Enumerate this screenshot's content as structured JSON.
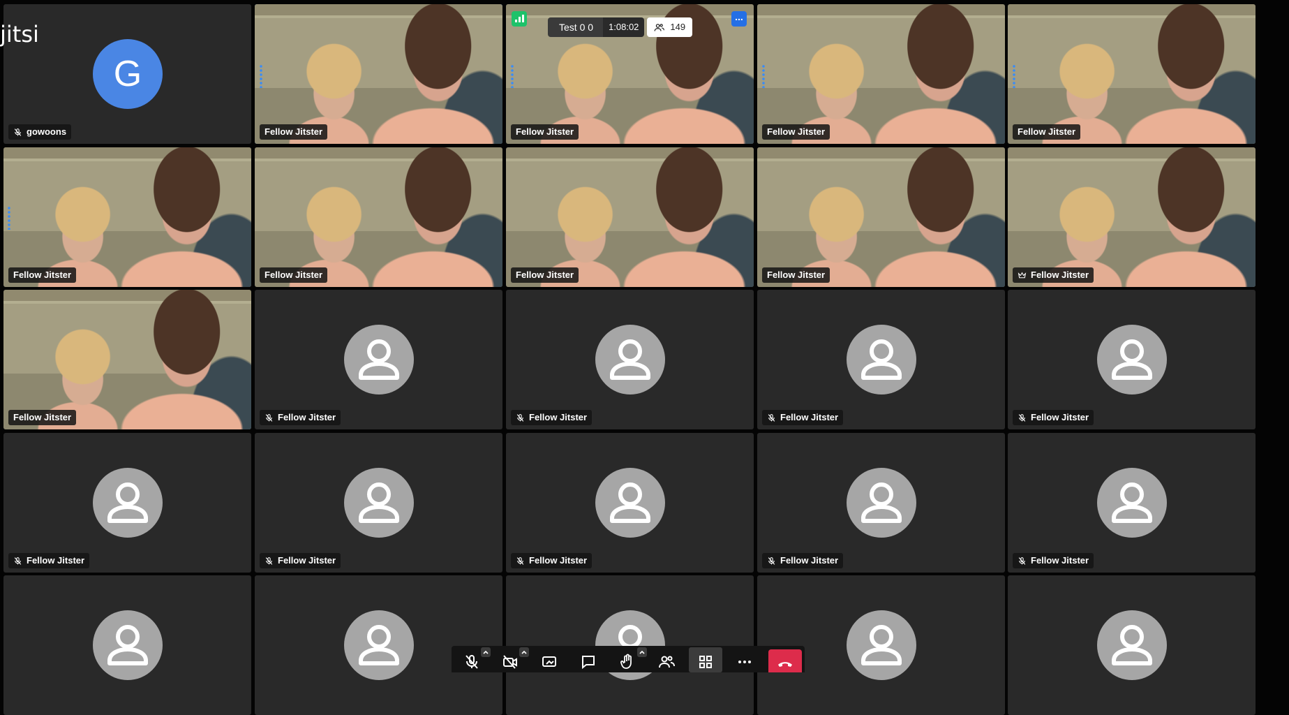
{
  "brand": {
    "watermark_text": "jitsi"
  },
  "meeting": {
    "title": "Test 0 0",
    "duration": "1:08:02",
    "participant_count": "149"
  },
  "colors": {
    "background": "#040404",
    "tile": "#292929",
    "selected_border": "#246fe5",
    "avatar_gray": "#a6a6a6",
    "avatar_letter_bg": "#4a86e4",
    "connection_good": "#1ec26a",
    "hangup_red": "#dd2c4b"
  },
  "participants": [
    {
      "name": "gowoons",
      "kind": "letter",
      "initial": "G",
      "muted": true
    },
    {
      "name": "Fellow Jitster",
      "kind": "video",
      "selected": true
    },
    {
      "name": "Fellow Jitster",
      "kind": "video"
    },
    {
      "name": "Fellow Jitster",
      "kind": "video"
    },
    {
      "name": "Fellow Jitster",
      "kind": "video"
    },
    {
      "name": "Fellow Jitster",
      "kind": "video"
    },
    {
      "name": "Fellow Jitster",
      "kind": "video"
    },
    {
      "name": "Fellow Jitster",
      "kind": "video"
    },
    {
      "name": "Fellow Jitster",
      "kind": "video"
    },
    {
      "name": "Fellow Jitster",
      "kind": "video",
      "moderator": true
    },
    {
      "name": "Fellow Jitster",
      "kind": "video"
    },
    {
      "name": "Fellow Jitster",
      "kind": "avatar",
      "muted": true
    },
    {
      "name": "Fellow Jitster",
      "kind": "avatar",
      "muted": true
    },
    {
      "name": "Fellow Jitster",
      "kind": "avatar",
      "muted": true
    },
    {
      "name": "Fellow Jitster",
      "kind": "avatar",
      "muted": true
    },
    {
      "name": "Fellow Jitster",
      "kind": "avatar",
      "muted": true
    },
    {
      "name": "Fellow Jitster",
      "kind": "avatar",
      "muted": true
    },
    {
      "name": "Fellow Jitster",
      "kind": "avatar",
      "muted": true
    },
    {
      "name": "Fellow Jitster",
      "kind": "avatar",
      "muted": true
    },
    {
      "name": "Fellow Jitster",
      "kind": "avatar",
      "muted": true
    },
    {
      "name": "",
      "kind": "avatar"
    },
    {
      "name": "",
      "kind": "avatar"
    },
    {
      "name": "",
      "kind": "avatar"
    },
    {
      "name": "",
      "kind": "avatar"
    },
    {
      "name": "",
      "kind": "avatar"
    }
  ],
  "toolbar": {
    "buttons": [
      {
        "icon": "microphone-muted-icon"
      },
      {
        "icon": "camera-off-icon"
      },
      {
        "icon": "screen-share-icon"
      },
      {
        "icon": "chat-icon"
      },
      {
        "icon": "raise-hand-icon"
      },
      {
        "icon": "participants-icon"
      },
      {
        "icon": "tile-view-icon",
        "active": true
      },
      {
        "icon": "more-options-icon"
      },
      {
        "icon": "hangup-icon"
      }
    ]
  }
}
